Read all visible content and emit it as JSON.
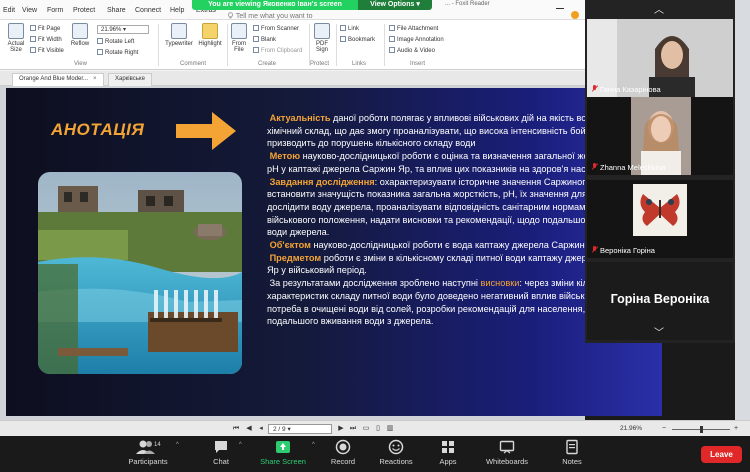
{
  "menubar": {
    "items": [
      "Edit",
      "View",
      "Form",
      "Protect",
      "Share",
      "Connect",
      "Help",
      "Extras"
    ],
    "tell_me": "Tell me what you want to",
    "app_title": "... - Foxit Reader"
  },
  "share_banner": {
    "text": "You are viewing Яковенко Іван's screen",
    "view_options": "View Options ▾"
  },
  "ribbon": {
    "actual_size": "Actual Size",
    "fit_page": "Fit Page",
    "fit_width": "Fit Width",
    "fit_visible": "Fit Visible",
    "reflow": "Reflow",
    "zoom_value": "21.96%",
    "rotate_left": "Rotate Left",
    "rotate_right": "Rotate Right",
    "typewriter": "Typewriter",
    "highlight": "Highlight",
    "from_file": "From File",
    "from_scanner": "From Scanner",
    "blank": "Blank",
    "from_clipboard": "From Clipboard",
    "pdf_sign": "PDF Sign",
    "link": "Link",
    "bookmark": "Bookmark",
    "file_attachment": "File Attachment",
    "image_annotation": "Image Annotation",
    "audio_video": "Audio & Video",
    "groups": {
      "view": "View",
      "comment": "Comment",
      "create": "Create",
      "protect": "Protect",
      "links": "Links",
      "insert": "Insert"
    }
  },
  "tabs": [
    {
      "label": "Orange And Blue Moder..."
    },
    {
      "label": "Харківське"
    }
  ],
  "slide": {
    "title": "АНОТАЦІЯ",
    "p1_hl": "Актуальність",
    "p1": " даної роботи полягає у впливові військових дій на якість води та її хімічний склад, що дає змогу проаналізувати, що висока інтенсивність бойових дій призводить до порушень кількісного складу води",
    "p2_hl": "Метою",
    "p2": " науково-дослідницької роботи є оцінка та визначення загальної жорсткості та pH у каптажі джерела Саржин Яр, та вплив цих показників на здоров'я населення.",
    "p3_hl": "Завдання дослідження",
    "p3": ": охарактеризувати історичне значення Саржиного Яру, встановити значущість показника загальна жорсткість, pH, їх значення для людини, дослідити воду джерела, проаналізувати відповідність санітарним нормам під час військового положення, надати висновки та рекомендації, щодо подальшого вживання води джерела.",
    "p4_hl": "Об'єктом",
    "p4": " науково-дослідницької роботи є вода каптажу джерела Саржин Яр",
    "p5_hl": "Предметом",
    "p5": " роботи є зміни в кількісному  складі питної води каптажу джерела Саржин Яр у військовий період.",
    "p6a": "За результатами дослідження зроблено наступні ",
    "p6_hl": "висновки",
    "p6b": ": через зміни кількісних характеристик складу питної води було доведено негативний вплив військових дій та потреба в очищені води від солей, розробки рекомендацій для населення, щодо подальшого вживання води з джерела."
  },
  "statusbar": {
    "page": "2 / 9",
    "zoom": "21.96%"
  },
  "participants": [
    {
      "name": "Ганна Казарінова"
    },
    {
      "name": "Zhanna Meleshkina"
    },
    {
      "name": "Вероніка Горіна"
    }
  ],
  "name_card": "Горіна Вероніка",
  "toolbar": {
    "participants": "Participants",
    "participants_count": "14",
    "chat": "Chat",
    "share_screen": "Share Screen",
    "record": "Record",
    "reactions": "Reactions",
    "apps": "Apps",
    "whiteboards": "Whiteboards",
    "notes": "Notes",
    "leave": "Leave"
  },
  "colors": {
    "accent_orange": "#f4a435",
    "zoom_green": "#23d160",
    "leave_red": "#e02828"
  }
}
